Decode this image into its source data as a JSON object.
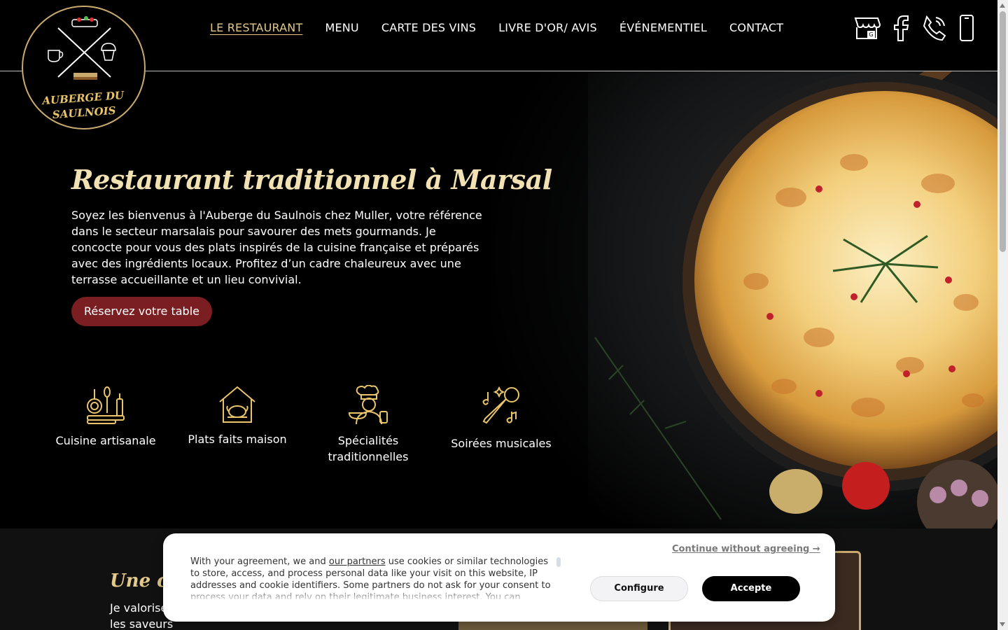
{
  "brand": {
    "name_line1": "AUBERGE DU",
    "name_line2": "SAULNOIS"
  },
  "nav": {
    "items": [
      {
        "label": "LE RESTAURANT",
        "active": true
      },
      {
        "label": "MENU"
      },
      {
        "label": "CARTE DES VINS"
      },
      {
        "label": "LIVRE D'OR/ AVIS"
      },
      {
        "label": "ÉVÉNEMENTIEL"
      },
      {
        "label": "CONTACT"
      }
    ]
  },
  "header_icons": [
    "google-business-icon",
    "facebook-icon",
    "phone-icon",
    "mobile-icon"
  ],
  "hero": {
    "title": "Restaurant traditionnel à Marsal",
    "text": "Soyez les bienvenus à l'Auberge du Saulnois chez Muller, votre référence dans le secteur marsalais pour savourer des mets gourmands. Je concocte pour vous des plats inspirés de la cuisine française et préparés avec des ingrédients locaux. Profitez d’un cadre chaleureux avec une terrasse accueillante et un lieu convivial.",
    "cta": "Réservez votre table"
  },
  "features": [
    {
      "label": "Cuisine artisanale",
      "icon": "cookware-icon"
    },
    {
      "label": "Plats faits maison",
      "icon": "house-roast-icon"
    },
    {
      "label": "Spécialités traditionnelles",
      "icon": "chef-icon"
    },
    {
      "label": "Soirées musicales",
      "icon": "microphone-icon"
    }
  ],
  "section2": {
    "title": "Une cui",
    "text": "Je valorise avec des plats faits maison qui reflètent les saveurs"
  },
  "cookie": {
    "text_before_link": "With your agreement, we and ",
    "link": "our partners",
    "text_after_link": " use cookies or similar technologies to store, access, and process personal data like your visit on this website, IP addresses and cookie identifiers. Some partners do not ask for your consent to process your data and rely on their legitimate business interest. You can",
    "continue": "Continue without agreeing →",
    "configure": "Configure",
    "accept": "Accepte"
  },
  "colors": {
    "gold": "#e3c98a",
    "cta": "#7a1e22",
    "background": "#000000"
  }
}
